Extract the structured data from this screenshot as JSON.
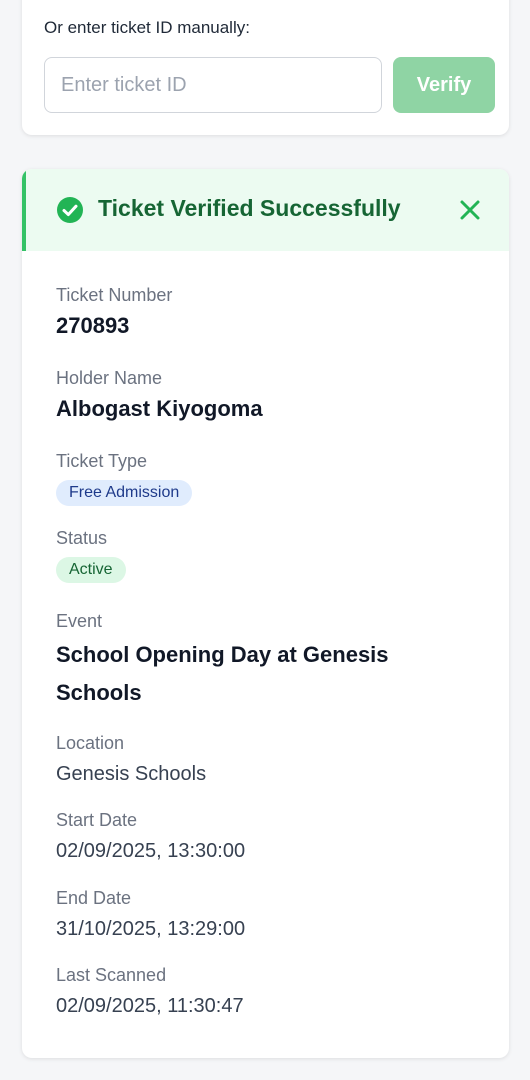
{
  "manual": {
    "label": "Or enter ticket ID manually:",
    "placeholder": "Enter ticket ID",
    "value": "",
    "verify_label": "Verify"
  },
  "result": {
    "banner_title": "Ticket Verified Successfully",
    "fields": {
      "ticket_number": {
        "label": "Ticket Number",
        "value": "270893"
      },
      "holder_name": {
        "label": "Holder Name",
        "value": "Albogast Kiyogoma"
      },
      "ticket_type": {
        "label": "Ticket Type",
        "value": "Free Admission"
      },
      "status": {
        "label": "Status",
        "value": "Active"
      },
      "event": {
        "label": "Event",
        "value": "School Opening Day at Genesis Schools"
      },
      "location": {
        "label": "Location",
        "value": "Genesis Schools"
      },
      "start_date": {
        "label": "Start Date",
        "value": "02/09/2025, 13:30:00"
      },
      "end_date": {
        "label": "End Date",
        "value": "31/10/2025, 13:29:00"
      },
      "last_scanned": {
        "label": "Last Scanned",
        "value": "02/09/2025, 11:30:47"
      }
    }
  },
  "colors": {
    "accent_green": "#34c266",
    "verify_button": "#8fd4a4",
    "banner_bg": "#ecfbf1",
    "badge_type_bg": "#e0ecfd",
    "badge_status_bg": "#dcf7e5"
  },
  "icons": {
    "success": "check-circle-icon",
    "close": "close-icon"
  }
}
